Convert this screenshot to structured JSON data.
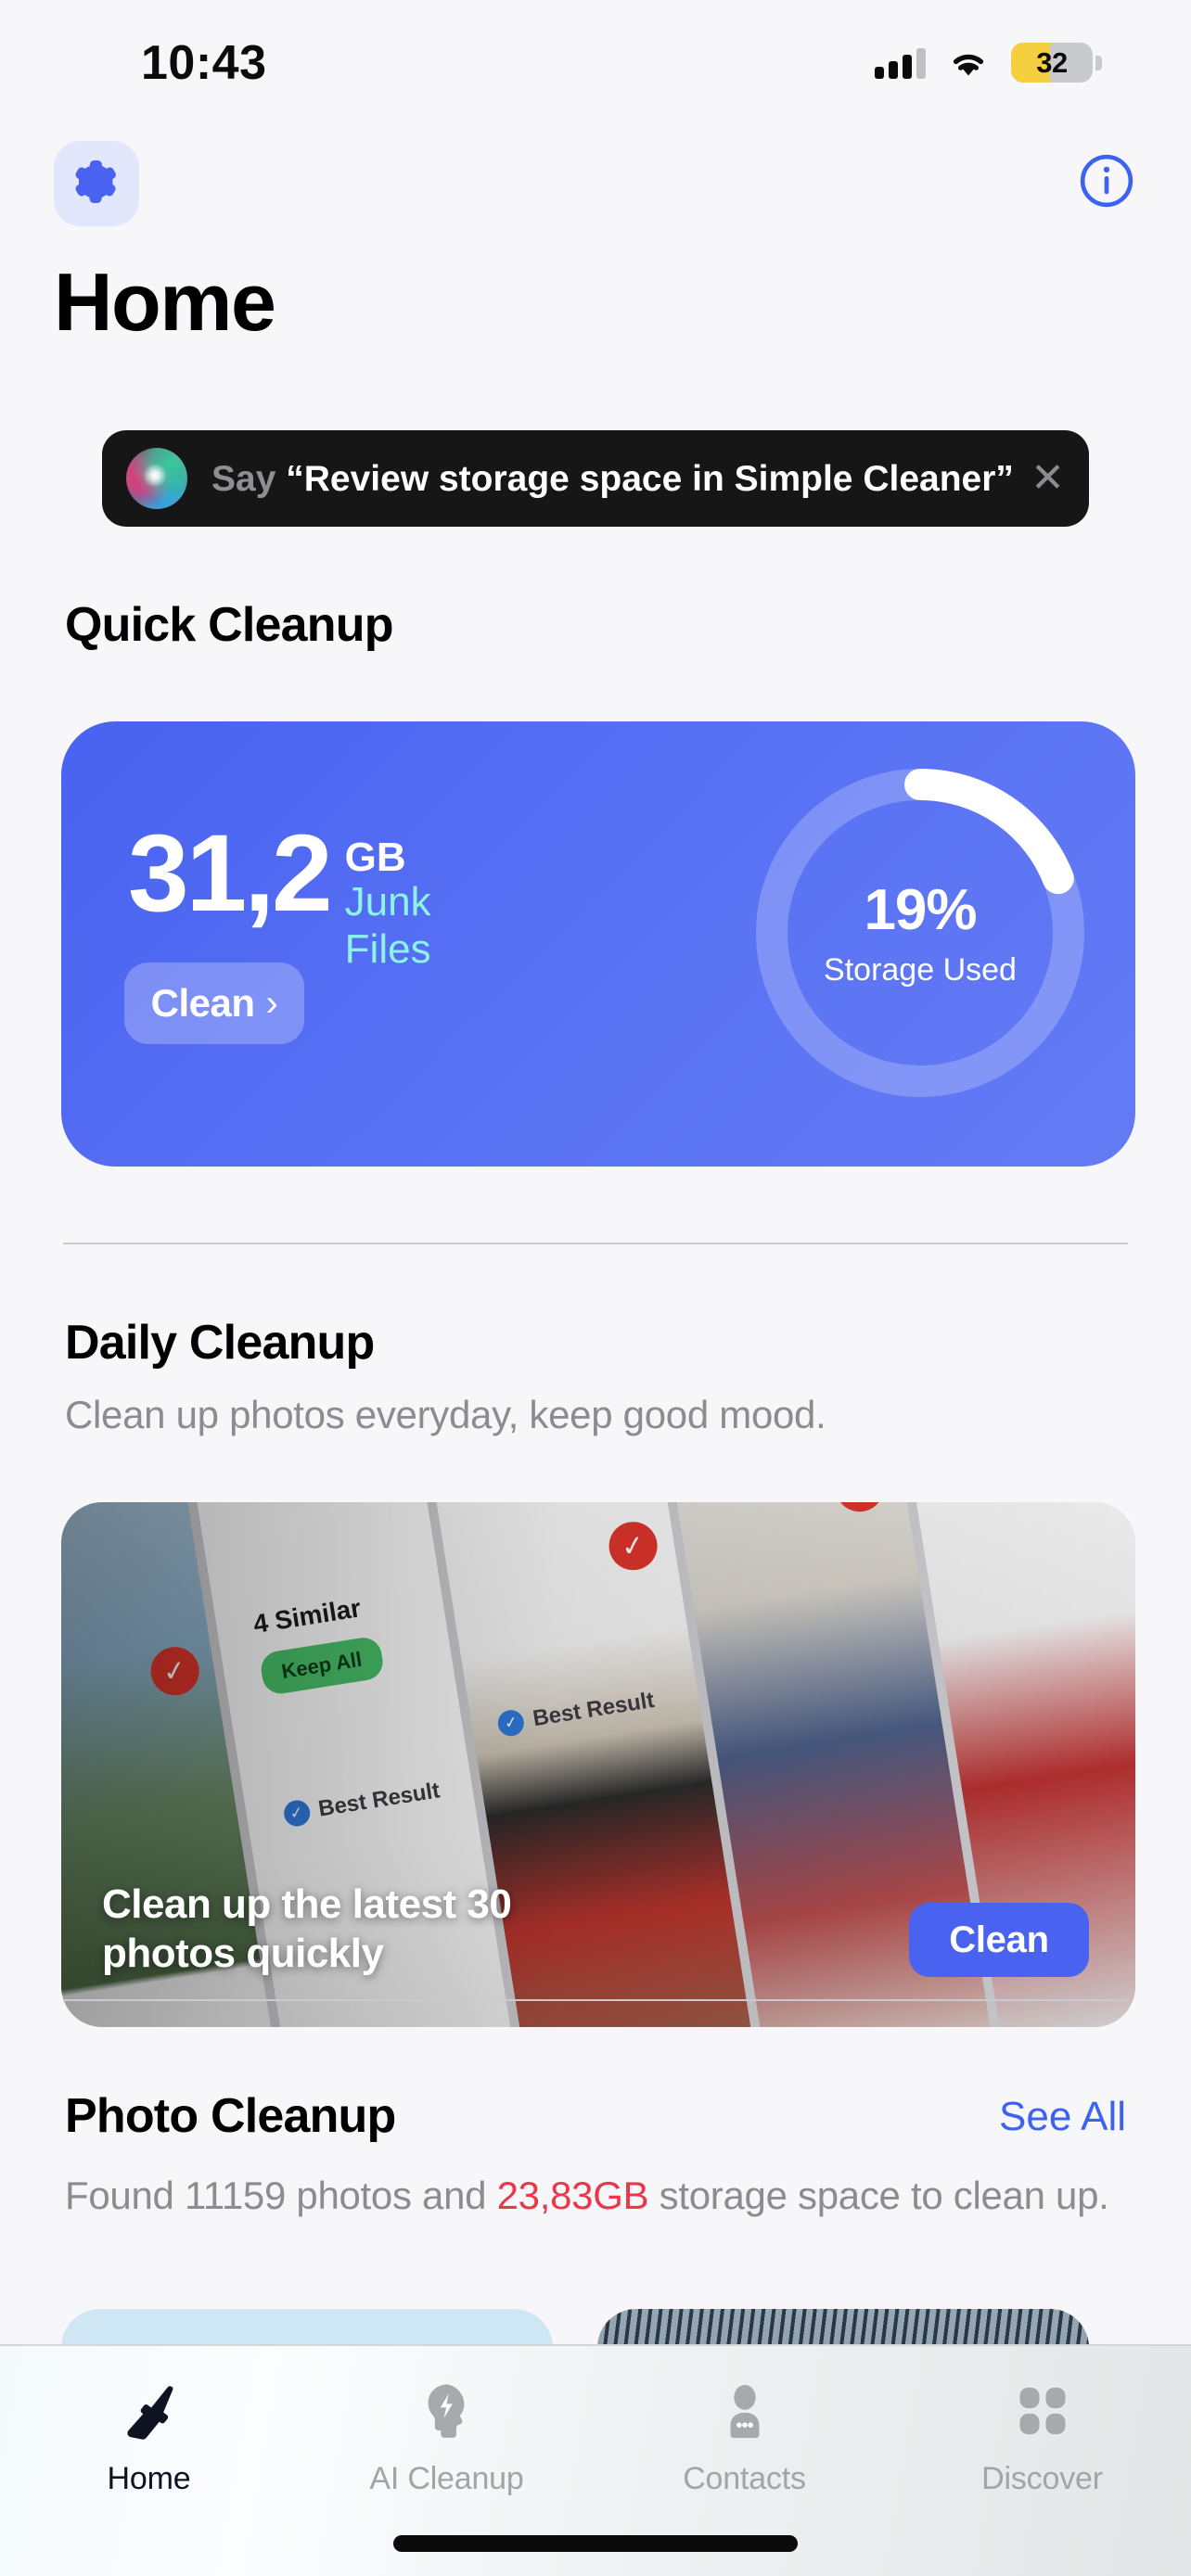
{
  "status_bar": {
    "time": "10:43",
    "battery_percent": "32",
    "signal_icon": "cellular-signal-icon",
    "wifi_icon": "wifi-icon",
    "battery_icon": "battery-icon"
  },
  "nav": {
    "settings_icon": "gear-icon",
    "info_icon": "info-circle-icon"
  },
  "header": {
    "title": "Home"
  },
  "siri_banner": {
    "orb_icon": "siri-orb-icon",
    "prefix": "Say",
    "phrase": "“Review storage space in Simple Cleaner”",
    "close_icon": "close-icon",
    "close_label": "✕"
  },
  "quick_cleanup": {
    "section_title": "Quick Cleanup",
    "amount": "31,2",
    "unit": "GB",
    "junk_label_line1": "Junk",
    "junk_label_line2": "Files",
    "clean_label": "Clean",
    "chevron": "›",
    "ring_percent_text": "19%",
    "ring_percent_value": 19,
    "ring_label": "Storage Used",
    "card_color": "#4962f0",
    "accent_mint": "#8df3e6"
  },
  "daily_cleanup": {
    "section_title": "Daily Cleanup",
    "subtitle": "Clean up photos everyday, keep good mood.",
    "caption": "Clean up the latest 30 photos quickly",
    "button_label": "Clean",
    "button_color": "#4962f0",
    "preview_badges": {
      "similar_label": "4 Similar",
      "keep_all_label": "Keep All",
      "best_result_label": "Best Result",
      "check_icon": "checkmark-icon",
      "verified_icon": "verified-badge-icon"
    }
  },
  "photo_cleanup": {
    "section_title": "Photo Cleanup",
    "see_all_label": "See All",
    "see_all_color": "#3b63f0",
    "desc_prefix": "Found 11159 photos and ",
    "desc_highlight": "23,83GB",
    "desc_suffix": " storage space to clean up.",
    "highlight_color": "#e8384a",
    "photo_count": "11159",
    "reclaimable": "23,83GB"
  },
  "tab_bar": {
    "items": [
      {
        "label": "Home",
        "icon": "broom-icon",
        "active": true
      },
      {
        "label": "AI Cleanup",
        "icon": "ai-head-bolt-icon",
        "active": false
      },
      {
        "label": "Contacts",
        "icon": "person-icon",
        "active": false
      },
      {
        "label": "Discover",
        "icon": "grid-squares-icon",
        "active": false
      }
    ]
  }
}
